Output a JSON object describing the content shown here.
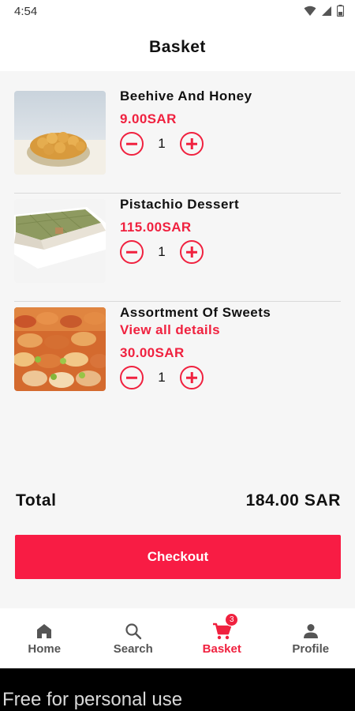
{
  "status_bar": {
    "time": "4:54",
    "icons": [
      "wifi-icon",
      "signal-icon",
      "battery-icon"
    ]
  },
  "header": {
    "title": "Basket"
  },
  "items": [
    {
      "title": "Beehive And Honey",
      "link": "",
      "price": "9.00SAR",
      "quantity": "1",
      "image": "honey-bread-image"
    },
    {
      "title": "Pistachio Dessert",
      "link": "",
      "price": "115.00SAR",
      "quantity": "1",
      "image": "pistachio-dessert-image"
    },
    {
      "title": "Assortment Of Sweets",
      "link": "View all details",
      "price": "30.00SAR",
      "quantity": "1",
      "image": "sweets-assortment-image"
    }
  ],
  "total": {
    "label": "Total",
    "value": "184.00 SAR"
  },
  "checkout": {
    "label": "Checkout"
  },
  "nav": {
    "items": [
      {
        "label": "Home",
        "icon": "home-icon"
      },
      {
        "label": "Search",
        "icon": "search-icon"
      },
      {
        "label": "Basket",
        "icon": "cart-icon",
        "badge": "3"
      },
      {
        "label": "Profile",
        "icon": "person-icon"
      }
    ],
    "active": "Basket"
  },
  "watermark": {
    "text": "Free for personal use"
  },
  "colors": {
    "accent": "#f0213f",
    "button": "#f81c44",
    "background": "#f6f6f6"
  }
}
